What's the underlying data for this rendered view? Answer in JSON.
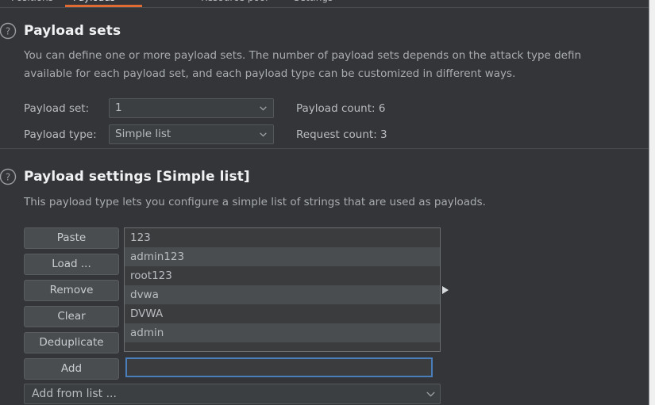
{
  "tabs": {
    "items": [
      {
        "label": "Positions",
        "active": false
      },
      {
        "label": "Payloads",
        "active": true
      },
      {
        "label": "Resource pool",
        "active": false
      },
      {
        "label": "Settings",
        "active": false
      }
    ],
    "active_accent_color": "#e06b33"
  },
  "payload_sets": {
    "icon": "help-circle-icon",
    "title": "Payload sets",
    "description_line1": "You can define one or more payload sets. The number of payload sets depends on the attack type defin",
    "description_line2": "available for each payload set, and each payload type can be customized in different ways.",
    "payload_set_label": "Payload set:",
    "payload_set_value": "1",
    "payload_type_label": "Payload type:",
    "payload_type_value": "Simple list",
    "payload_count": "Payload count: 6",
    "request_count": "Request count: 3",
    "dropdown_icon": "chevron-down-icon"
  },
  "payload_settings": {
    "icon": "help-circle-icon",
    "title": "Payload settings [Simple list]",
    "description": "This payload type lets you configure a simple list of strings that are used as payloads.",
    "buttons": [
      {
        "label": "Paste",
        "name": "paste-button"
      },
      {
        "label": "Load ...",
        "name": "load-button"
      },
      {
        "label": "Remove",
        "name": "remove-button"
      },
      {
        "label": "Clear",
        "name": "clear-button"
      },
      {
        "label": "Deduplicate",
        "name": "deduplicate-button"
      },
      {
        "label": "Add",
        "name": "add-button"
      }
    ],
    "payload_list": [
      "123",
      "admin123",
      "root123",
      "dvwa",
      "DVWA",
      "admin"
    ],
    "add_input_value": "",
    "add_input_placeholder": "",
    "add_from_list_value": "Add from list ...",
    "splitter_icon": "triangle-right-icon",
    "dropdown_icon": "chevron-down-icon"
  },
  "theme": {
    "background": "#333538",
    "panel": "#3c3f42",
    "button": "#4a4d50",
    "text_primary": "#f0f1f2",
    "text_secondary": "#b9bcbf",
    "text_muted": "#a9acaf",
    "border": "#55585b",
    "focus_border": "#4a7ebb",
    "accent": "#e06b33",
    "row_odd": "#3a3c3e",
    "row_even": "#4a4d4f"
  }
}
